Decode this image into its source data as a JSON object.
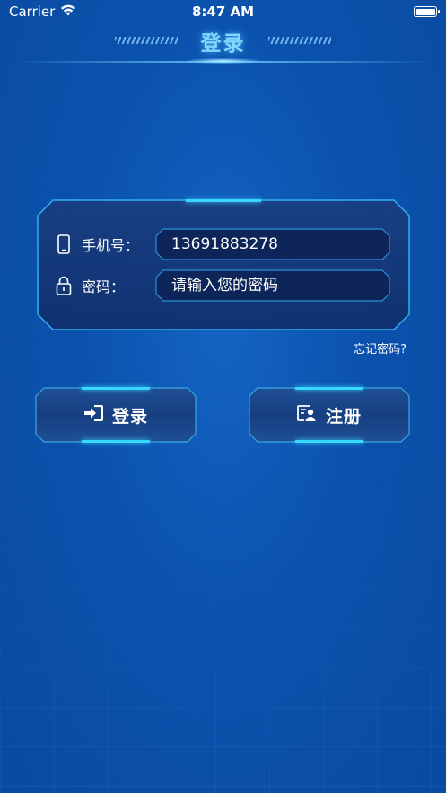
{
  "status_bar": {
    "carrier": "Carrier",
    "time": "8:47 AM"
  },
  "header": {
    "title": "登录"
  },
  "form": {
    "phone_label": "手机号：",
    "phone_value": "13691883278",
    "password_label": "密码：",
    "password_placeholder": "请输入您的密码"
  },
  "forgot_password": "忘记密码?",
  "buttons": {
    "login_label": "登录",
    "register_label": "注册"
  },
  "icons": {
    "wifi": "wifi-icon",
    "battery": "battery-icon",
    "phone": "phone-icon",
    "lock": "lock-icon",
    "login": "login-arrow-icon",
    "register": "id-card-icon"
  },
  "colors": {
    "background": "#0b52ad",
    "accent": "#37d7ff",
    "panel": "#10306e",
    "input_fill": "#0d2558"
  }
}
